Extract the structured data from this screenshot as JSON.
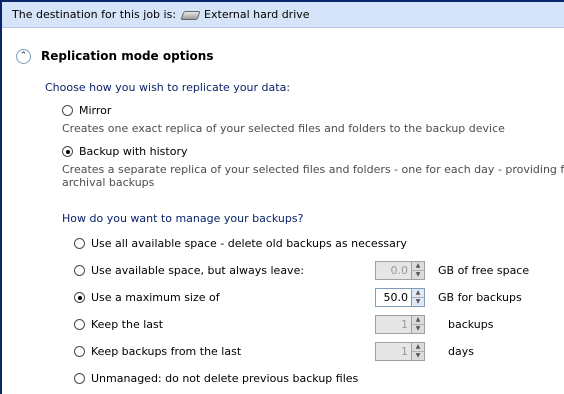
{
  "destination": {
    "prefix": "The destination for this job is:",
    "drive": "External hard drive",
    "drive_icon": "hard-drive-icon"
  },
  "section": {
    "title": "Replication mode options",
    "collapse_icon": "chevron-up-double-icon"
  },
  "replication": {
    "prompt": "Choose how you wish to replicate your data:",
    "options": [
      {
        "label": "Mirror",
        "description": "Creates one exact replica of your selected files and folders to the backup device",
        "selected": false
      },
      {
        "label": "Backup with history",
        "description_line1": "Creates a separate replica of your selected files and folders - one for each day - providing fo",
        "description_line2": "archival backups",
        "selected": true
      }
    ]
  },
  "manage": {
    "prompt": "How do you want to manage your backups?",
    "options": [
      {
        "label": "Use all available space - delete old backups as necessary",
        "selected": false
      },
      {
        "label": "Use available space, but always leave:",
        "value": "0.0",
        "unit": "GB of free space",
        "enabled": false,
        "selected": false
      },
      {
        "label": "Use a maximum size of",
        "value": "50.0",
        "unit": "GB for backups",
        "enabled": true,
        "selected": true
      },
      {
        "label": "Keep the last",
        "value": "1",
        "unit": "backups",
        "enabled": false,
        "selected": false
      },
      {
        "label": "Keep backups from the last",
        "value": "1",
        "unit": "days",
        "enabled": false,
        "selected": false
      },
      {
        "label": "Unmanaged: do not delete previous backup files",
        "selected": false
      }
    ]
  },
  "colors": {
    "header_bar": "#d6e4fa",
    "prompt_text": "#0a246a",
    "frame_border": "#0a246a"
  }
}
